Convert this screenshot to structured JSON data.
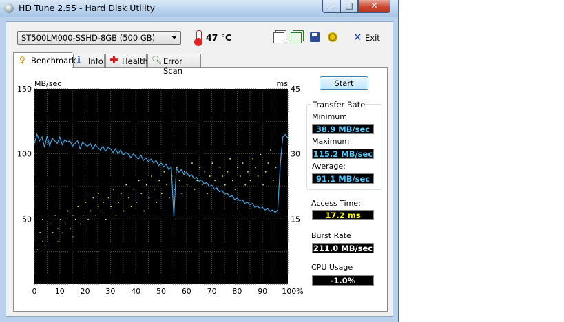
{
  "window": {
    "title": "HD Tune 2.55 - Hard Disk Utility",
    "controls": {
      "minimize": "–",
      "maximize": "□",
      "close": "✕"
    }
  },
  "toolbar": {
    "drive": "ST500LM000-SSHD-8GB (500 GB)",
    "temperature": "47 °C",
    "icons": [
      "copy-icon",
      "copy-options-icon",
      "save-icon",
      "health-options-icon"
    ],
    "exit_label": "Exit"
  },
  "tabs": [
    {
      "label": "Benchmark",
      "active": true
    },
    {
      "label": "Info",
      "active": false
    },
    {
      "label": "Health",
      "active": false
    },
    {
      "label": "Error Scan",
      "active": false
    }
  ],
  "colors": {
    "chart_bg": "#000000",
    "grid": "#3e5a4c",
    "transfer_line": "#3aa7e8",
    "access_dots": "#e6e23a",
    "value_cyan": "#55c8ff",
    "value_yellow": "#ffff00"
  },
  "chart_data": {
    "type": "line",
    "y_left_label": "MB/sec",
    "y_right_label": "ms",
    "y_left_ticks": [
      "150",
      "100",
      "50"
    ],
    "y_right_ticks": [
      "45",
      "30",
      "15"
    ],
    "x_ticks": [
      "0",
      "10",
      "20",
      "30",
      "40",
      "50",
      "60",
      "70",
      "80",
      "90",
      "100%"
    ],
    "xlim": [
      0,
      100
    ],
    "ylim_left": [
      0,
      150
    ],
    "ylim_right": [
      0,
      45
    ],
    "grid": true,
    "series": [
      {
        "axis": "left",
        "x": [
          0,
          1,
          2,
          3,
          4,
          5,
          6,
          7,
          8,
          9,
          10,
          11,
          12,
          13,
          14,
          15,
          16,
          17,
          18,
          19,
          20,
          21,
          22,
          23,
          24,
          25,
          26,
          27,
          28,
          29,
          30,
          31,
          32,
          33,
          34,
          35,
          36,
          37,
          38,
          39,
          40,
          41,
          42,
          43,
          44,
          45,
          46,
          47,
          48,
          49,
          50,
          51,
          52,
          53,
          54,
          55,
          56,
          57,
          58,
          59,
          60,
          61,
          62,
          63,
          64,
          65,
          66,
          67,
          68,
          69,
          70,
          71,
          72,
          73,
          74,
          75,
          76,
          77,
          78,
          79,
          80,
          81,
          82,
          83,
          84,
          85,
          86,
          87,
          88,
          89,
          90,
          91,
          92,
          93,
          94,
          95,
          96,
          97,
          98,
          99,
          100
        ],
        "y": [
          108,
          115,
          110,
          113,
          105,
          114,
          106,
          112,
          110,
          108,
          113,
          107,
          111,
          109,
          110,
          106,
          108,
          110,
          104,
          109,
          107,
          106,
          108,
          104,
          107,
          105,
          103,
          106,
          102,
          105,
          104,
          101,
          104,
          100,
          103,
          99,
          101,
          100,
          97,
          100,
          98,
          96,
          99,
          95,
          97,
          94,
          96,
          93,
          95,
          91,
          93,
          90,
          92,
          88,
          90,
          52,
          89,
          86,
          88,
          84,
          86,
          83,
          84,
          81,
          82,
          79,
          80,
          77,
          78,
          75,
          76,
          73,
          74,
          71,
          72,
          69,
          70,
          67,
          68,
          65,
          66,
          64,
          65,
          62,
          63,
          61,
          62,
          59,
          60,
          58,
          59,
          57,
          58,
          56,
          57,
          55,
          57,
          92,
          113,
          115,
          112
        ]
      },
      {
        "axis": "right",
        "x": [
          1,
          2,
          3,
          3,
          4,
          5,
          5,
          6,
          7,
          8,
          9,
          9,
          10,
          11,
          12,
          13,
          14,
          15,
          15,
          16,
          17,
          18,
          19,
          20,
          21,
          22,
          23,
          24,
          25,
          25,
          26,
          27,
          28,
          29,
          30,
          31,
          32,
          33,
          34,
          35,
          36,
          37,
          38,
          39,
          40,
          41,
          42,
          43,
          44,
          45,
          46,
          47,
          48,
          49,
          50,
          51,
          52,
          53,
          54,
          55,
          56,
          57,
          58,
          59,
          60,
          61,
          62,
          63,
          64,
          65,
          66,
          67,
          68,
          69,
          70,
          71,
          72,
          73,
          74,
          75,
          76,
          77,
          78,
          79,
          80,
          81,
          82,
          83,
          84,
          85,
          86,
          87,
          88,
          89,
          90,
          91,
          92,
          93,
          94,
          95
        ],
        "y": [
          8,
          12,
          10,
          15,
          9,
          13,
          11,
          14,
          12,
          16,
          10,
          13,
          15,
          12,
          14,
          17,
          13,
          16,
          11,
          15,
          18,
          14,
          16,
          19,
          15,
          17,
          20,
          16,
          18,
          21,
          17,
          19,
          15,
          20,
          18,
          22,
          16,
          19,
          21,
          17,
          23,
          20,
          18,
          22,
          19,
          24,
          21,
          17,
          23,
          20,
          25,
          22,
          19,
          24,
          21,
          26,
          23,
          20,
          25,
          22,
          27,
          24,
          21,
          26,
          23,
          25,
          28,
          22,
          24,
          27,
          23,
          26,
          21,
          25,
          28,
          24,
          22,
          27,
          25,
          23,
          26,
          29,
          24,
          22,
          27,
          25,
          28,
          23,
          26,
          24,
          29,
          27,
          25,
          30,
          23,
          26,
          28,
          31,
          24,
          27
        ]
      }
    ]
  },
  "panel": {
    "start_label": "Start",
    "transfer_rate_title": "Transfer Rate",
    "minimum_label": "Minimum",
    "minimum_value": "38.9 MB/sec",
    "maximum_label": "Maximum",
    "maximum_value": "115.2 MB/sec",
    "average_label": "Average:",
    "average_value": "91.1 MB/sec",
    "access_time_label": "Access Time:",
    "access_time_value": "17.2 ms",
    "burst_rate_label": "Burst Rate",
    "burst_rate_value": "211.0 MB/sec",
    "cpu_usage_label": "CPU Usage",
    "cpu_usage_value": "-1.0%"
  }
}
